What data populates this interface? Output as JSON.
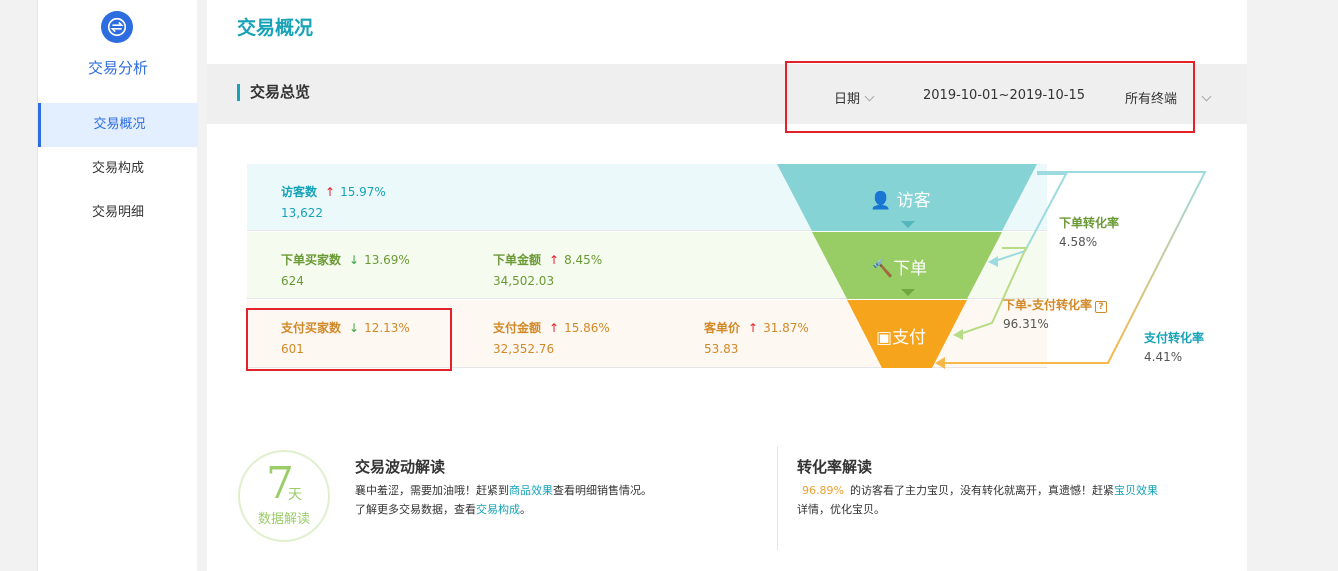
{
  "sidebar": {
    "brand_title": "交易分析",
    "items": [
      {
        "label": "交易概况",
        "active": true
      },
      {
        "label": "交易构成",
        "active": false
      },
      {
        "label": "交易明细",
        "active": false
      }
    ]
  },
  "main": {
    "page_title": "交易概况",
    "section_title": "交易总览",
    "filters": {
      "date_label": "日期",
      "date_range": "2019-10-01~2019-10-15",
      "terminal": "所有终端"
    }
  },
  "funnel_rows": {
    "visitors": {
      "label": "访客数",
      "pct": "15.97%",
      "trend": "up",
      "value": "13,622"
    },
    "order_buyers": {
      "label": "下单买家数",
      "pct": "13.69%",
      "trend": "down",
      "value": "624"
    },
    "order_amount": {
      "label": "下单金额",
      "pct": "8.45%",
      "trend": "up",
      "value": "34,502.03"
    },
    "pay_buyers": {
      "label": "支付买家数",
      "pct": "12.13%",
      "trend": "down",
      "value": "601"
    },
    "pay_amount": {
      "label": "支付金额",
      "pct": "15.86%",
      "trend": "up",
      "value": "32,352.76"
    },
    "avg_price": {
      "label": "客单价",
      "pct": "31.87%",
      "trend": "up",
      "value": "53.83"
    }
  },
  "funnel": {
    "stage_visit": "访客",
    "stage_order": "下单",
    "stage_pay": "支付",
    "order_rate_label": "下单转化率",
    "order_rate": "4.58%",
    "order_pay_rate_label": "下单-支付转化率",
    "order_pay_rate": "96.31%",
    "pay_rate_label": "支付转化率",
    "pay_rate": "4.41%",
    "colors": {
      "visit": "#86d3d6",
      "order": "#98cc64",
      "pay": "#f7a41d"
    }
  },
  "bottom": {
    "badge_num": "7",
    "badge_unit": "天",
    "badge_sub": "数据解读",
    "fluct_title": "交易波动解读",
    "fluct_line1_a": "襄中羞涩，需要加油哦！赶紧到",
    "fluct_line1_link": "商品效果",
    "fluct_line1_b": "查看明细销售情况。",
    "fluct_line2_a": "了解更多交易数据，查看",
    "fluct_line2_link": "交易构成",
    "fluct_line2_b": "。",
    "conv_title": "转化率解读",
    "conv_pct": "96.89%",
    "conv_line1_a": "的访客看了主力宝贝，没有转化就离开，真遗憾！赶紧",
    "conv_line1_link": "宝贝效果",
    "conv_line2": "详情，优化宝贝。"
  }
}
